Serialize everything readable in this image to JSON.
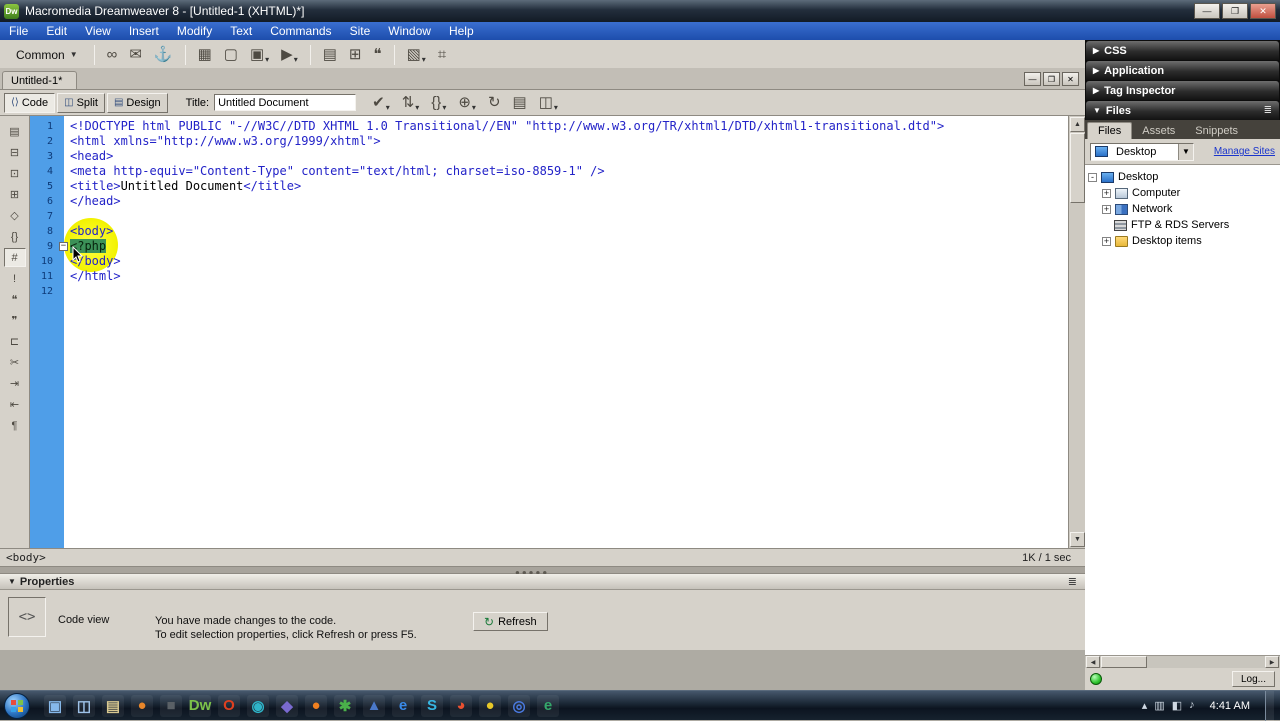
{
  "titlebar": {
    "title": "Macromedia Dreamweaver 8 - [Untitled-1 (XHTML)*]",
    "app_badge": "Dw"
  },
  "menu": {
    "items": [
      "File",
      "Edit",
      "View",
      "Insert",
      "Modify",
      "Text",
      "Commands",
      "Site",
      "Window",
      "Help"
    ]
  },
  "insert_bar": {
    "category": "Common",
    "icons": [
      {
        "name": "hyperlink-icon",
        "g": "∞"
      },
      {
        "name": "email-link-icon",
        "g": "✉"
      },
      {
        "name": "named-anchor-icon",
        "g": "⚓"
      },
      {
        "sep": true
      },
      {
        "name": "table-icon",
        "g": "▦"
      },
      {
        "name": "insert-div-icon",
        "g": "▢"
      },
      {
        "name": "images-icon",
        "g": "▣",
        "dd": true
      },
      {
        "name": "media-icon",
        "g": "▶",
        "dd": true
      },
      {
        "sep": true
      },
      {
        "name": "date-icon",
        "g": "▤"
      },
      {
        "name": "server-include-icon",
        "g": "⊞"
      },
      {
        "name": "comment-icon",
        "g": "❝"
      },
      {
        "sep": true
      },
      {
        "name": "templates-icon",
        "g": "▧",
        "dd": true
      },
      {
        "name": "tag-chooser-icon",
        "g": "⌗"
      }
    ]
  },
  "document": {
    "tab": "Untitled-1*",
    "toolbar": {
      "code": "Code",
      "split": "Split",
      "design": "Design",
      "title_label": "Title:",
      "title_value": "Untitled Document",
      "icons": [
        {
          "name": "browser-check-icon",
          "g": "✔",
          "dd": true
        },
        {
          "name": "file-management-icon",
          "g": "⇅",
          "dd": true
        },
        {
          "name": "code-navigation-icon",
          "g": "{}",
          "dd": true
        },
        {
          "name": "preview-browser-icon",
          "g": "⊕",
          "dd": true
        },
        {
          "name": "refresh-icon",
          "g": "↻"
        },
        {
          "name": "view-options-icon",
          "g": "▤"
        },
        {
          "name": "visual-aids-icon",
          "g": "◫",
          "dd": true
        }
      ]
    },
    "coding_toolbar_icons": [
      {
        "name": "open-documents-icon",
        "g": "▤"
      },
      {
        "name": "collapse-full-tag-icon",
        "g": "⊟"
      },
      {
        "name": "collapse-selection-icon",
        "g": "⊡"
      },
      {
        "name": "expand-all-icon",
        "g": "⊞"
      },
      {
        "name": "select-parent-tag-icon",
        "g": "◇"
      },
      {
        "name": "balance-braces-icon",
        "g": "{}"
      },
      {
        "name": "line-numbers-icon",
        "g": "#",
        "active": true
      },
      {
        "name": "highlight-invalid-icon",
        "g": "!"
      },
      {
        "name": "apply-comment-icon",
        "g": "❝"
      },
      {
        "name": "remove-comment-icon",
        "g": "❞"
      },
      {
        "name": "wrap-tag-icon",
        "g": "⊏"
      },
      {
        "name": "recent-snippets-icon",
        "g": "✂"
      },
      {
        "name": "indent-icon",
        "g": "⇥"
      },
      {
        "name": "outdent-icon",
        "g": "⇤"
      },
      {
        "name": "format-code-icon",
        "g": "¶"
      }
    ],
    "code_lines": [
      {
        "n": "1",
        "segs": [
          {
            "t": "<!DOCTYPE html PUBLIC \"-//W3C//DTD XHTML 1.0 Transitional//EN\" \"http://www.w3.org/TR/xhtml1/DTD/xhtml1-transitional.dtd\">",
            "c": "tag"
          }
        ]
      },
      {
        "n": "2",
        "segs": [
          {
            "t": "<html xmlns=\"http://www.w3.org/1999/xhtml\">",
            "c": "tag"
          }
        ]
      },
      {
        "n": "3",
        "segs": [
          {
            "t": "<head>",
            "c": "tag"
          }
        ]
      },
      {
        "n": "4",
        "segs": [
          {
            "t": "<meta http-equiv=\"Content-Type\" content=\"text/html; charset=iso-8859-1\" />",
            "c": "tag"
          }
        ]
      },
      {
        "n": "5",
        "segs": [
          {
            "t": "<title>",
            "c": "tag"
          },
          {
            "t": "Untitled Document",
            "c": "text"
          },
          {
            "t": "</title>",
            "c": "tag"
          }
        ]
      },
      {
        "n": "6",
        "segs": [
          {
            "t": "</head>",
            "c": "tag"
          }
        ]
      },
      {
        "n": "7",
        "segs": []
      },
      {
        "n": "8",
        "segs": [
          {
            "t": "<body>",
            "c": "tag"
          }
        ]
      },
      {
        "n": "9",
        "fold": true,
        "segs": [
          {
            "t": "<?php",
            "c": "sel"
          }
        ]
      },
      {
        "n": "10",
        "segs": [
          {
            "t": "</body>",
            "c": "tag"
          }
        ]
      },
      {
        "n": "11",
        "segs": [
          {
            "t": "</html>",
            "c": "tag"
          }
        ]
      },
      {
        "n": "12",
        "segs": []
      }
    ],
    "status": {
      "tag": "<body>",
      "stats": "1K / 1 sec"
    }
  },
  "properties": {
    "header": "Properties",
    "view_label": "Code view",
    "icon": "<>",
    "message1": "You have made changes to the code.",
    "message2": "To edit selection properties, click Refresh or press F5.",
    "refresh": "Refresh"
  },
  "panels": {
    "collapsed": [
      {
        "label": "CSS"
      },
      {
        "label": "Application"
      },
      {
        "label": "Tag Inspector"
      }
    ],
    "files": {
      "header": "Files",
      "tabs": [
        "Files",
        "Assets",
        "Snippets"
      ],
      "active_tab": "Files",
      "site": "Desktop",
      "manage": "Manage Sites",
      "tree": [
        {
          "label": "Desktop",
          "level": 0,
          "icon": "desktop",
          "expand": "-"
        },
        {
          "label": "Computer",
          "level": 1,
          "icon": "computer",
          "expand": "+"
        },
        {
          "label": "Network",
          "level": 1,
          "icon": "network",
          "expand": "+"
        },
        {
          "label": "FTP & RDS Servers",
          "level": 1,
          "icon": "server",
          "expand": ""
        },
        {
          "label": "Desktop items",
          "level": 1,
          "icon": "folder",
          "expand": "+"
        }
      ],
      "log_button": "Log..."
    }
  },
  "taskbar": {
    "time": "4:41 AM",
    "icons": [
      {
        "g": "▣",
        "c": "#86b8ea"
      },
      {
        "g": "◫",
        "c": "#9ec2e8"
      },
      {
        "g": "▤",
        "c": "#d8c890"
      },
      {
        "g": "●",
        "c": "#e8862a"
      },
      {
        "g": "■",
        "c": "#5a6066"
      },
      {
        "g": "Dw",
        "c": "#7cc24a"
      },
      {
        "g": "O",
        "c": "#e04020"
      },
      {
        "g": "◉",
        "c": "#2fb4c8"
      },
      {
        "g": "◆",
        "c": "#7a6ad0"
      },
      {
        "g": "●",
        "c": "#f08020"
      },
      {
        "g": "✱",
        "c": "#4ab04a"
      },
      {
        "g": "▲",
        "c": "#4a78c8"
      },
      {
        "g": "e",
        "c": "#3a8ae8"
      },
      {
        "g": "S",
        "c": "#37b6e2"
      },
      {
        "g": "◕",
        "c": "#e85030"
      },
      {
        "g": "●",
        "c": "#e8c828"
      },
      {
        "g": "◎",
        "c": "#4a7ae0"
      },
      {
        "g": "e",
        "c": "#34a86a"
      }
    ],
    "tray_icons": [
      {
        "g": "▴",
        "c": "#cfd8e2"
      },
      {
        "g": "▥",
        "c": "#cfd8e2"
      },
      {
        "g": "◧",
        "c": "#cfd8e2"
      },
      {
        "g": "♪",
        "c": "#cfd8e2"
      }
    ]
  },
  "colors": {
    "gutter_blue": "#4f9ee8",
    "highlight_yellow": "#f2f200",
    "selection_green": "#3c9158",
    "code_tag_blue": "#2323c8"
  }
}
